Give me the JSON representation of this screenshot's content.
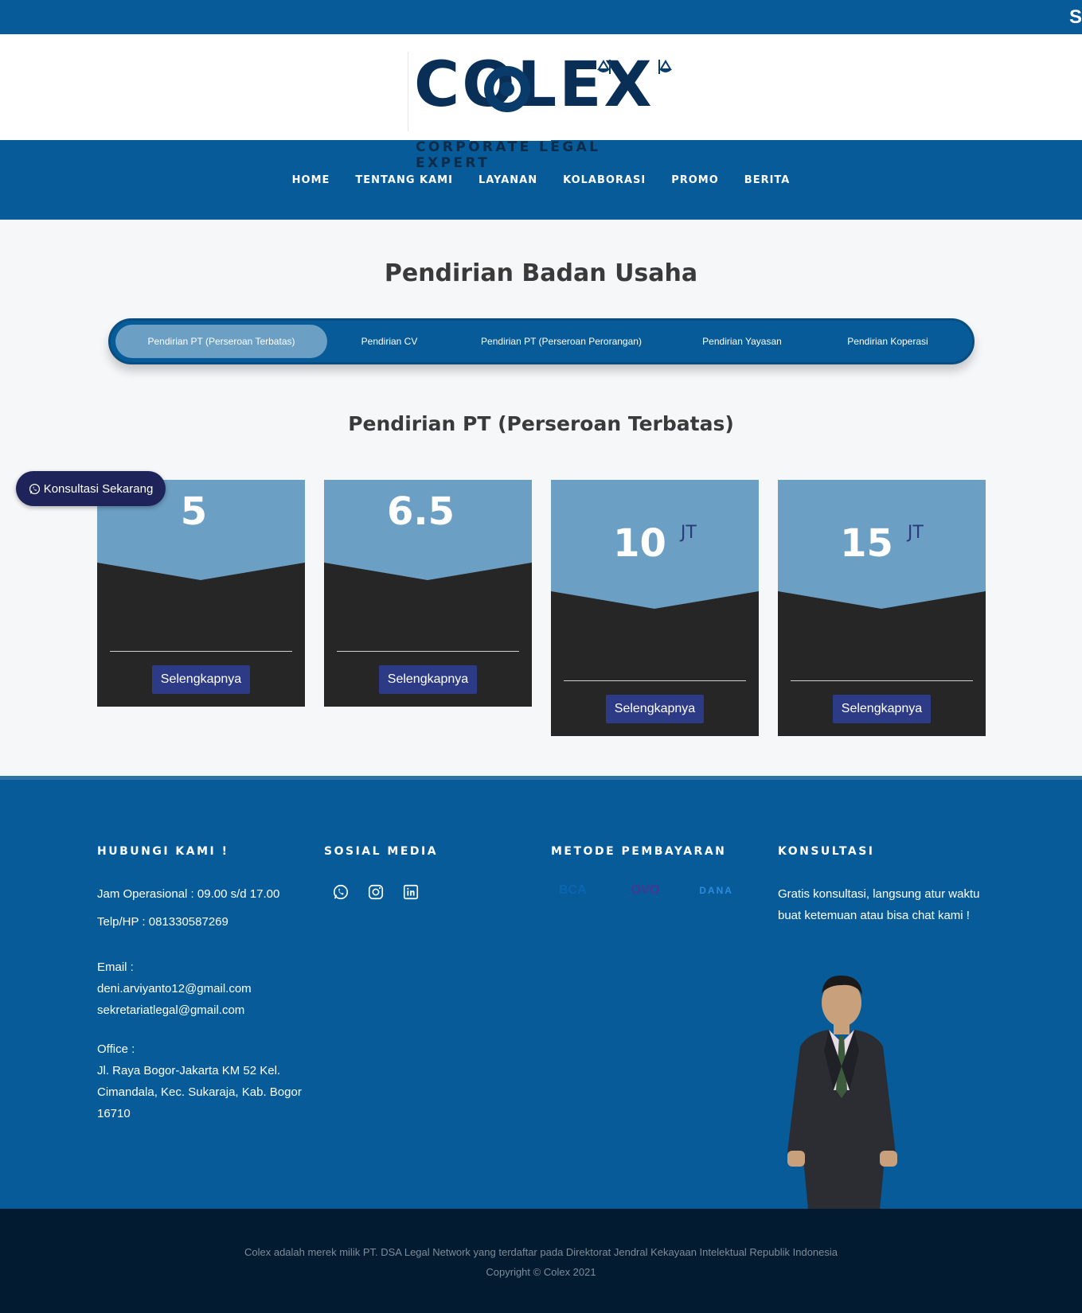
{
  "header": {
    "edge_text": "S"
  },
  "logo": {
    "wordmark": "COLEX",
    "tagline": "CORPORATE LEGAL EXPERT"
  },
  "nav": {
    "items": [
      "HOME",
      "TENTANG KAMI",
      "LAYANAN",
      "KOLABORASI",
      "PROMO",
      "BERITA"
    ]
  },
  "page": {
    "title": "Pendirian Badan Usaha",
    "section_title": "Pendirian PT (Perseroan Terbatas)"
  },
  "tabs": [
    {
      "label": "Pendirian PT (Perseroan Terbatas)",
      "active": true
    },
    {
      "label": "Pendirian CV",
      "active": false
    },
    {
      "label": "Pendirian PT (Perseroan Perorangan)",
      "active": false
    },
    {
      "label": "Pendirian Yayasan",
      "active": false
    },
    {
      "label": "Pendirian Koperasi",
      "active": false
    }
  ],
  "cards": [
    {
      "price": "5",
      "unit": "",
      "button": "Selengkapnya"
    },
    {
      "price": "6.5",
      "unit": "",
      "button": "Selengkapnya"
    },
    {
      "price": "10",
      "unit": "JT",
      "button": "Selengkapnya"
    },
    {
      "price": "15",
      "unit": "JT",
      "button": "Selengkapnya"
    }
  ],
  "float_button": {
    "label": "Konsultasi Sekarang"
  },
  "footer": {
    "contact": {
      "heading": "HUBUNGI KAMI !",
      "hours": "Jam Operasional : 09.00 s/d 17.00",
      "phone": "Telp/HP : 081330587269",
      "email_label": "Email :",
      "email_1": "deni.arviyanto12@gmail.com",
      "email_2": "sekretariatlegal@gmail.com",
      "office_label": "Office :",
      "office_address": "Jl. Raya Bogor-Jakarta KM 52 Kel. Cimandala, Kec. Sukaraja, Kab. Bogor 16710"
    },
    "social": {
      "heading": "SOSIAL MEDIA",
      "icons": [
        "whatsapp-icon",
        "instagram-icon",
        "linkedin-icon"
      ]
    },
    "payment": {
      "heading": "METODE PEMBAYARAN",
      "methods": [
        "BCA",
        "OVO",
        "DANA"
      ]
    },
    "consult": {
      "heading": "KONSULTASI",
      "text": "Gratis konsultasi, langsung atur waktu buat ketemuan atau bisa chat kami !"
    }
  },
  "bottom": {
    "line1": "Colex adalah merek milik PT. DSA Legal Network yang terdaftar pada Direktorat Jendral Kekayaan Intelektual Republik Indonesia",
    "line2": "Copyright © Colex 2021"
  },
  "colors": {
    "primary": "#065b98",
    "tab_active": "#6b9fc4",
    "card_dark": "#262626",
    "button": "#2d3a86",
    "footer_bottom": "#021b31"
  }
}
